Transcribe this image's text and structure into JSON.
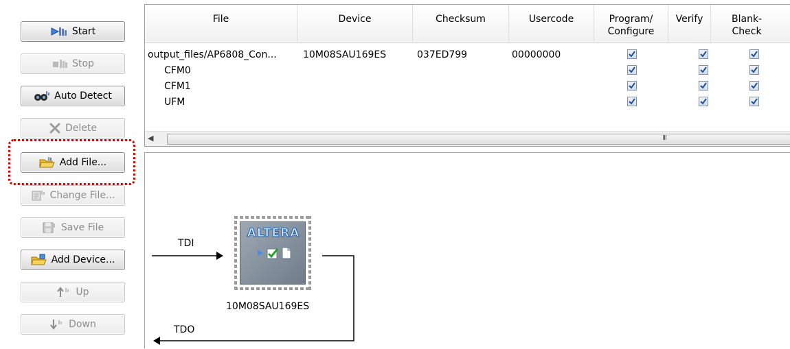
{
  "toolbar": {
    "start": "Start",
    "stop": "Stop",
    "auto_detect": "Auto Detect",
    "delete": "Delete",
    "add_file": "Add File...",
    "change_file": "Change File...",
    "save_file": "Save File",
    "add_device": "Add Device...",
    "up": "Up",
    "down": "Down"
  },
  "table": {
    "headers": {
      "file": "File",
      "device": "Device",
      "checksum": "Checksum",
      "usercode": "Usercode",
      "program_1": "Program/",
      "program_2": "Configure",
      "verify": "Verify",
      "blank_1": "Blank-",
      "blank_2": "Check"
    },
    "rows": [
      {
        "file": "output_files/AP6808_Con...",
        "device": "10M08SAU169ES",
        "checksum": "037ED799",
        "usercode": "00000000",
        "program": true,
        "verify": true,
        "blank": true
      },
      {
        "file": "CFM0",
        "device": "",
        "checksum": "",
        "usercode": "",
        "program": true,
        "verify": true,
        "blank": true
      },
      {
        "file": "CFM1",
        "device": "",
        "checksum": "",
        "usercode": "",
        "program": true,
        "verify": true,
        "blank": true
      },
      {
        "file": "UFM",
        "device": "",
        "checksum": "",
        "usercode": "",
        "program": true,
        "verify": true,
        "blank": true
      }
    ],
    "scroll_grip": "III"
  },
  "diagram": {
    "tdi": "TDI",
    "tdo": "TDO",
    "chip_logo": "ALTERA",
    "chip_name": "10M08SAU169ES"
  },
  "colors": {
    "highlight": "#d40000",
    "check": "#1c4f9c"
  }
}
